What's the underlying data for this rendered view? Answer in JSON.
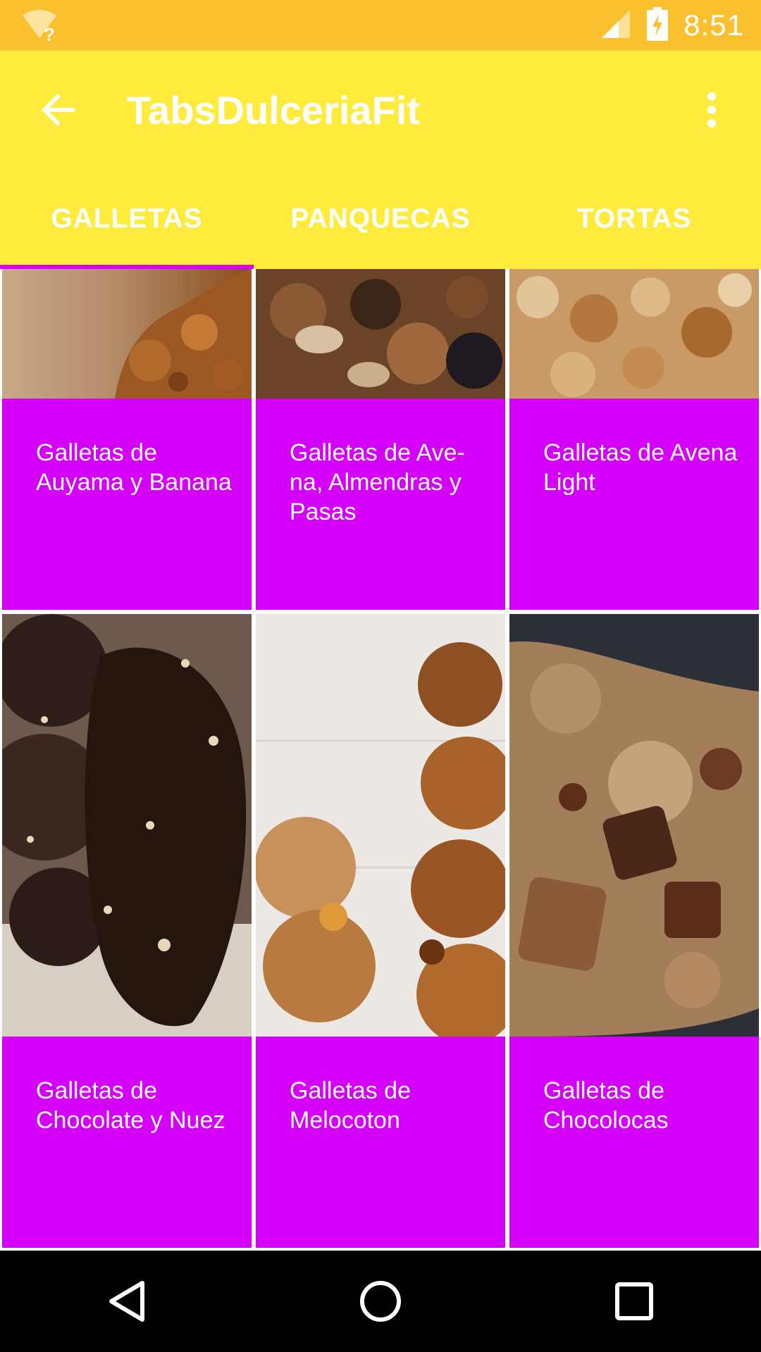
{
  "status_bar": {
    "time": "8:51",
    "icons": [
      "wifi-unknown-icon",
      "cell-signal-icon",
      "battery-charging-icon"
    ]
  },
  "app_bar": {
    "title": "TabsDulceriaFit",
    "back_icon": "arrow-back-icon",
    "menu_icon": "more-vert-icon"
  },
  "tabs": [
    {
      "label": "GALLETAS",
      "active": true
    },
    {
      "label": "PANQUECAS",
      "active": false
    },
    {
      "label": "TORTAS",
      "active": false
    }
  ],
  "colors": {
    "status_bar": "#FBC02D",
    "app_bar": "#FFEB3B",
    "accent": "#D500F9",
    "nav_bar": "#000000"
  },
  "cards": [
    {
      "title": "Galletas de Auyama y Banana"
    },
    {
      "title": "Galletas de Ave-na, Almendras y Pasas"
    },
    {
      "title": "Galletas de Avena Light"
    },
    {
      "title": "Galletas de Chocolate y Nuez"
    },
    {
      "title": "Galletas de Melocoton"
    },
    {
      "title": "Galletas de Chocolocas"
    }
  ],
  "nav_bar": {
    "icons": [
      "nav-back-icon",
      "nav-home-icon",
      "nav-recents-icon"
    ]
  }
}
